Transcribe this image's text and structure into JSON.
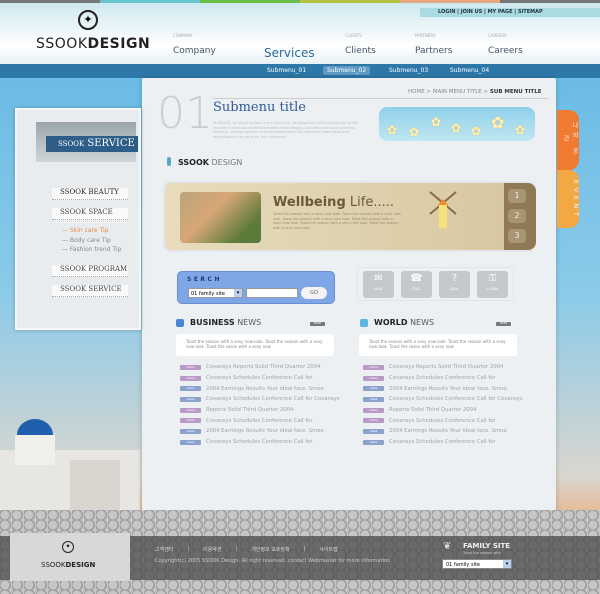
{
  "brand": {
    "logo_light": "SSOOK",
    "logo_bold": "DESIGN",
    "stripe_colors": [
      "#777777",
      "#67c6cc",
      "#6bbd4a",
      "#b7c03c",
      "#e5a880",
      "#777777"
    ]
  },
  "util_links": "LOGIN | JOIN US | MY PAGE | SITEMAP",
  "nav": [
    {
      "small": "COMPANY",
      "label": "Company"
    },
    {
      "small": "",
      "label": "Services",
      "active": true
    },
    {
      "small": "CLIENTS",
      "label": "Clients"
    },
    {
      "small": "PARTNERS",
      "label": "Partners"
    },
    {
      "small": "CAREERS",
      "label": "Careers"
    }
  ],
  "submenu": [
    "Submenu_01",
    "Submenu_02",
    "Submenu_03",
    "Submenu_04"
  ],
  "submenu_active": 1,
  "page": {
    "number": "01",
    "title": "Submenu title",
    "breadcrumb_pre": "HOME > MAIN MENU TITLE > ",
    "breadcrumb_current": "SUB MENU TITLE",
    "description": "At SSOOK, we strive to lead in the invention, development and manufacture of the industry's most advanced information technologies, including computer systems, software, storage systems and microelectronics.We translate these advanced technologies into value for our customers.",
    "section_bold": "SSOOK",
    "section_light": " DESIGN"
  },
  "banner": {
    "title_bold": "Wellbeing",
    "title_light": " Life.....",
    "text": "Toast the season with a sexy new look. Toast the season with a sexy new look. Toast the season with a sexy new look. Toast the season with a sexy new look. Toast the season with a sexy new look. Toast the season with a sexy new look.",
    "pages": [
      "1",
      "2",
      "3"
    ]
  },
  "search": {
    "label": "SERCH",
    "select": "01 family site",
    "input": "",
    "go": "GO"
  },
  "quick": [
    {
      "icon": "mail-icon",
      "glyph": "✉",
      "label": "MAIL"
    },
    {
      "icon": "phone-icon",
      "glyph": "☎",
      "label": "CALL"
    },
    {
      "icon": "question-icon",
      "glyph": "?",
      "label": "Q&A"
    },
    {
      "icon": "key-icon",
      "glyph": "⚿",
      "label": "LOGIN"
    }
  ],
  "business": {
    "bold": "BUSINESS",
    "light": " NEWS",
    "more": "MORE",
    "color": "#4a86d8",
    "intro": "Toast the season with a sexy now look. Toast the season with a sexy now look .Toast the sason with a sexy now",
    "items": [
      {
        "tag": "notice",
        "text": "Covansys Reports Solid Third Quarter 2004"
      },
      {
        "tag": "notice",
        "text": "Covansys Schedules Conference Call for"
      },
      {
        "tag": "news",
        "text": "2004 Earnings Results Your ideal face. Smoo"
      },
      {
        "tag": "news",
        "text": "Covansys Schedules Conference Call for Covansys"
      },
      {
        "tag": "notice",
        "text": "Reports Solid Third Quarter 2004"
      },
      {
        "tag": "notice",
        "text": "Covansys Schedules Conference Call for"
      },
      {
        "tag": "news",
        "text": "2004 Earnings Results Your ideal face. Smoo"
      },
      {
        "tag": "news",
        "text": "Covansys Schedules Conference Call for"
      }
    ]
  },
  "world": {
    "bold": "WORLD",
    "light": " NEWS",
    "more": "MORE",
    "color": "#5bb6e0",
    "intro": "Toast the season with a sexy now look. Toast the season with a sexy now look. Toast the sason with a sexy now",
    "items": [
      {
        "tag": "notice",
        "text": "Covansys Reports Solid Third Quarter 2004"
      },
      {
        "tag": "notice",
        "text": "Covansys Schedules Conference Call for"
      },
      {
        "tag": "news",
        "text": "2004 Earnings Results Your ideal face. Smoo"
      },
      {
        "tag": "news",
        "text": "Covansys Schedules Conference Call for Covansys"
      },
      {
        "tag": "notice",
        "text": "Reports Solid Third Quarter 2004"
      },
      {
        "tag": "notice",
        "text": "Covansys Schedules Conference Call for"
      },
      {
        "tag": "news",
        "text": "2004 Earnings Results Your ideal face. Smoo"
      },
      {
        "tag": "news",
        "text": "Covansys Schedules Conference Call for"
      }
    ]
  },
  "tags": {
    "notice": "notice",
    "news": "news"
  },
  "sidebar": {
    "title_small": "SSOOK",
    "title_big": " SERVICE",
    "menu": [
      "SSOOK BEAUTY",
      "SSOOK SPACE",
      "SSOOK PROGRAM",
      "SSOOK SERVICE"
    ],
    "sub": [
      "— Skin care Tip",
      "— Body care Tip",
      "— Fashion trend Tip"
    ],
    "sub_active": 0
  },
  "side_tabs": [
    {
      "label": "나의 공간",
      "color": "#ef7a30"
    },
    {
      "label": "EVENT",
      "color": "#f3a843"
    }
  ],
  "footer": {
    "logo_light": "SSOOK",
    "logo_bold": "DESIGN",
    "links": [
      "고객센터",
      "|",
      "이용약관",
      "|",
      "개인정보 보호정책",
      "|",
      "사이트맵"
    ],
    "copyright": "Copyright(c) 2005 SSOOK Design. All right reserved. contact Webmaster for more information",
    "family_title": "FAMILY SITE",
    "family_sub": "Toast the season with",
    "family_select": "01 family site"
  }
}
